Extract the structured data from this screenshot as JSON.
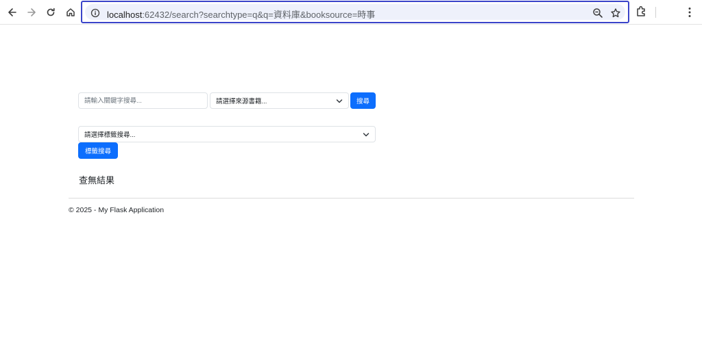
{
  "browser": {
    "url_host": "localhost",
    "url_rest": ":62432/search?searchtype=q&q=資料庫&booksource=時事",
    "icons": {
      "back": "arrow-left-icon",
      "forward": "arrow-right-icon",
      "reload": "reload-icon",
      "home": "home-icon",
      "site_info": "info-icon",
      "zoom": "zoom-out-icon",
      "bookmark": "star-icon",
      "extensions": "puzzle-icon",
      "menu": "kebab-menu-icon"
    }
  },
  "search": {
    "keyword_placeholder": "請輸入關鍵字搜尋...",
    "source_select_value": "請選擇來源書籍...",
    "search_button_label": "搜尋"
  },
  "tag_search": {
    "select_value": "請選擇標籤搜尋...",
    "button_label": "標籤搜尋"
  },
  "results": {
    "message": "查無結果"
  },
  "footer": {
    "text": "© 2025 - My Flask Application"
  },
  "colors": {
    "primary": "#0d6efd",
    "omnibox_border": "#3a43c9"
  }
}
